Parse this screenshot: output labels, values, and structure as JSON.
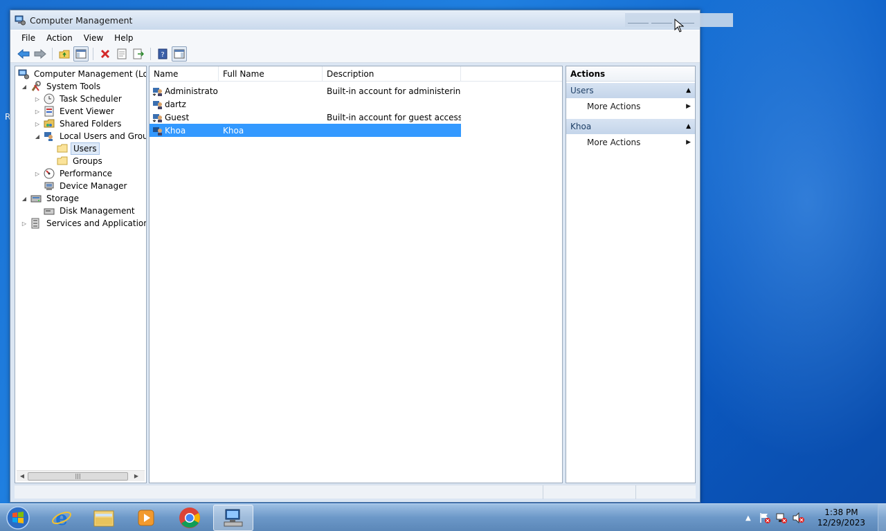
{
  "window": {
    "title": "Computer Management"
  },
  "desktop": {
    "edge_fragment": "R"
  },
  "menu": [
    "File",
    "Action",
    "View",
    "Help"
  ],
  "toolbar": {
    "buttons": [
      "back-icon",
      "forward-icon",
      "up-folder-icon",
      "show-hide-tree-icon",
      "delete-icon",
      "properties-icon",
      "export-list-icon",
      "help-icon",
      "show-hide-action-pane-icon"
    ]
  },
  "tree": {
    "items": [
      {
        "label": "Computer Management (Local",
        "level": 0,
        "expander": "",
        "icon": "computer-management-icon"
      },
      {
        "label": "System Tools",
        "level": 1,
        "expander": "◢",
        "icon": "system-tools-icon"
      },
      {
        "label": "Task Scheduler",
        "level": 2,
        "expander": "▷",
        "icon": "clock-icon"
      },
      {
        "label": "Event Viewer",
        "level": 2,
        "expander": "▷",
        "icon": "event-viewer-icon"
      },
      {
        "label": "Shared Folders",
        "level": 2,
        "expander": "▷",
        "icon": "shared-folder-icon"
      },
      {
        "label": "Local Users and Groups",
        "level": 2,
        "expander": "◢",
        "icon": "users-groups-icon"
      },
      {
        "label": "Users",
        "level": 3,
        "expander": "",
        "icon": "folder-icon",
        "selected": true
      },
      {
        "label": "Groups",
        "level": 3,
        "expander": "",
        "icon": "folder-icon"
      },
      {
        "label": "Performance",
        "level": 2,
        "expander": "▷",
        "icon": "performance-icon"
      },
      {
        "label": "Device Manager",
        "level": 2,
        "expander": "",
        "icon": "device-manager-icon"
      },
      {
        "label": "Storage",
        "level": 1,
        "expander": "◢",
        "icon": "storage-icon"
      },
      {
        "label": "Disk Management",
        "level": 2,
        "expander": "",
        "icon": "disk-icon"
      },
      {
        "label": "Services and Applications",
        "level": 1,
        "expander": "▷",
        "icon": "services-icon"
      }
    ]
  },
  "list": {
    "columns": [
      "Name",
      "Full Name",
      "Description"
    ],
    "rows": [
      {
        "name": "Administrator",
        "full_name": "",
        "description": "Built-in account for administering..."
      },
      {
        "name": "dartz",
        "full_name": "",
        "description": ""
      },
      {
        "name": "Guest",
        "full_name": "",
        "description": "Built-in account for guest access t..."
      },
      {
        "name": "Khoa",
        "full_name": "Khoa",
        "description": "",
        "selected": true
      }
    ]
  },
  "actions": {
    "title": "Actions",
    "sections": [
      {
        "header": "Users",
        "items": [
          "More Actions"
        ]
      },
      {
        "header": "Khoa",
        "items": [
          "More Actions"
        ]
      }
    ]
  },
  "taskbar": {
    "apps": [
      "internet-explorer-icon",
      "windows-explorer-icon",
      "media-player-icon",
      "chrome-icon",
      "computer-management-icon"
    ],
    "clock": {
      "time": "1:38 PM",
      "date": "12/29/2023"
    }
  }
}
